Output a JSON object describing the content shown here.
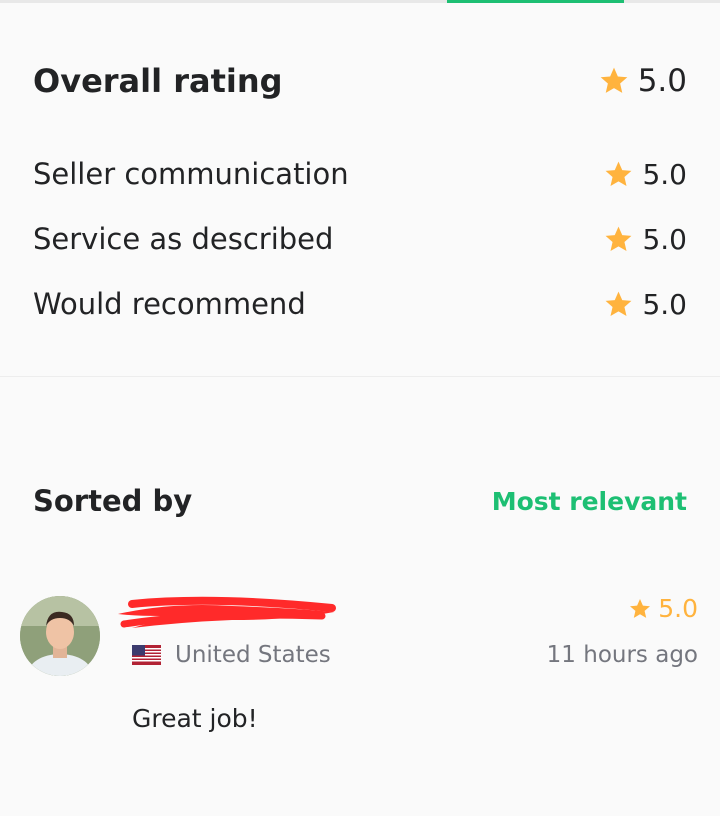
{
  "colors": {
    "accent": "#1dbf73",
    "star": "#ffb33e",
    "text": "#222325",
    "muted": "#74767e"
  },
  "ratings": {
    "overall": {
      "label": "Overall rating",
      "score": "5.0",
      "icon": "star-icon"
    },
    "items": [
      {
        "label": "Seller communication",
        "score": "5.0",
        "icon": "star-icon"
      },
      {
        "label": "Service as described",
        "score": "5.0",
        "icon": "star-icon"
      },
      {
        "label": "Would recommend",
        "score": "5.0",
        "icon": "star-icon"
      }
    ]
  },
  "sort": {
    "label": "Sorted by",
    "value": "Most relevant"
  },
  "review": {
    "country_flag": "us-flag-icon",
    "country": "United States",
    "score": "5.0",
    "time": "11 hours ago",
    "comment": "Great job!"
  }
}
